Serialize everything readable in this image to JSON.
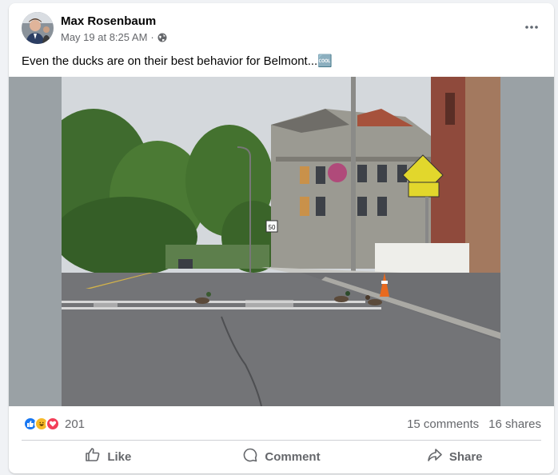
{
  "post": {
    "author": "Max Rosenbaum",
    "timestamp": "May 19 at 8:25 AM",
    "separator": "·",
    "privacy_icon": "globe-icon",
    "caption": "Even the ducks are on their best behavior for Belmont...🆒",
    "more_icon": "more-options-icon"
  },
  "photo": {
    "description_icon": "photo",
    "signs": {
      "route_number": "50"
    }
  },
  "stats": {
    "reaction_icons": [
      "like-reaction-icon",
      "haha-reaction-icon",
      "love-reaction-icon"
    ],
    "reaction_count": "201",
    "comments": "15 comments",
    "shares": "16 shares"
  },
  "actions": {
    "like": "Like",
    "comment": "Comment",
    "share": "Share"
  },
  "colors": {
    "like_blue": "#1877f2",
    "haha_yellow": "#f7b928",
    "love_red": "#f33e58",
    "secondary_text": "#65676b"
  }
}
